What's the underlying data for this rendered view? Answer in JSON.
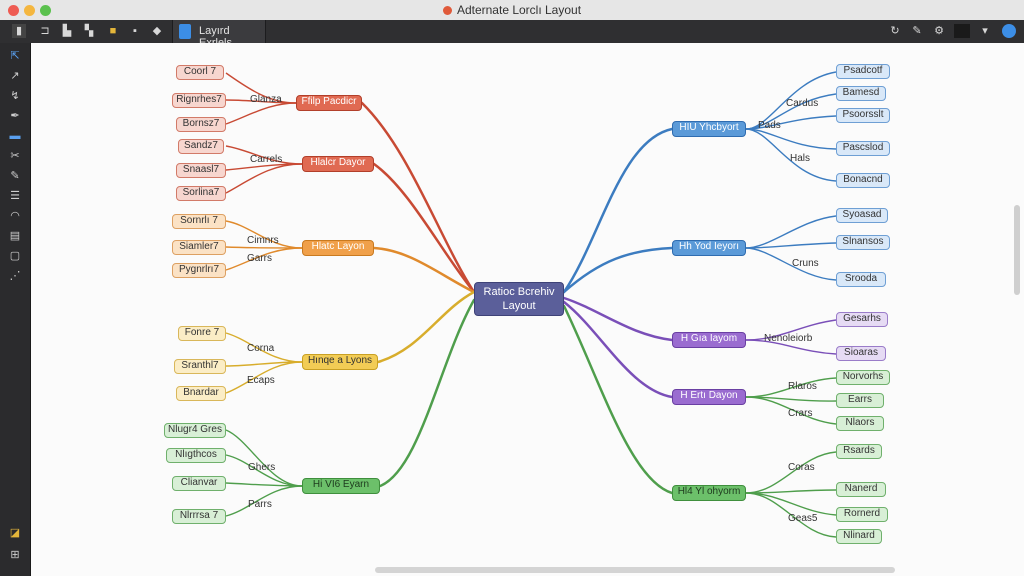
{
  "window": {
    "title": "Adternate Lorclı Layout"
  },
  "tab": {
    "label": "Layırd Exrlels"
  },
  "toolbar": {
    "left_icons": [
      "sidebar-icon",
      "back-icon",
      "copy-icon",
      "file-icon",
      "doc-icon",
      "cube-icon"
    ],
    "right_icons": [
      "refresh-icon",
      "pin-icon",
      "settings-icon",
      "square-icon",
      "chevron-down-icon",
      "profile-icon"
    ]
  },
  "mindmap": {
    "center": {
      "line1": "Ratioc Bcrehiv",
      "line2": "Layout"
    },
    "left": [
      {
        "label": "Ffilp Pacdicr",
        "color": "#e06a52",
        "border": "#b23f2a",
        "mid": "Glanza",
        "leaves": [
          "Coorl 7",
          "Rignrhes7",
          "Bornsz7"
        ]
      },
      {
        "label": "Hlalcr Dayor",
        "color": "#e06a52",
        "border": "#b23f2a",
        "mid": "Carrels",
        "leaves": [
          "Sandz7",
          "Snaasl7",
          "Sorlina7"
        ]
      },
      {
        "label": "Hlatc Layon",
        "color": "#f0a04a",
        "border": "#c97a20",
        "mid1": "Cimnrs",
        "mid2": "Garrs",
        "leaves": [
          "Sornrlı 7",
          "Siamler7",
          "Pygnrlrı7"
        ]
      },
      {
        "label": "Hınqe a Lyons",
        "color": "#f2cc55",
        "border": "#c9a024",
        "mid1": "Corna",
        "mid2": "Ecaps",
        "leaves": [
          "Fonre 7",
          "Sranthl7",
          "Bnardar"
        ]
      },
      {
        "label": "Hi VI6 Eyarn",
        "color": "#6cc06a",
        "border": "#3f8f3d",
        "mid1": "Ghers",
        "mid2": "Parrs",
        "leaves": [
          "Nlugr4 Gres",
          "Nlıgthcos",
          "Clianvar",
          "Nlrrrsa 7"
        ]
      }
    ],
    "right": [
      {
        "label": "HIU Yhcbyort",
        "color": "#5b9ad8",
        "border": "#2f6cb0",
        "mids": [
          "Pads",
          "Cardus",
          "Hals"
        ],
        "leaves": [
          "Psadcotf",
          "Bamesd",
          "Psoorsslt",
          "Pascslod",
          "Bonacnd"
        ]
      },
      {
        "label": "Hh Yod Ieyorı",
        "color": "#5b9ad8",
        "border": "#2f6cb0",
        "mids": [
          "Cruns"
        ],
        "leaves": [
          "Syoasad",
          "Slnansos",
          "Srooda"
        ]
      },
      {
        "label": "H Gıa Iayom",
        "color": "#9a6cd0",
        "border": "#6a3fa3",
        "mids": [
          "Nenoleiorb"
        ],
        "leaves": [
          "Gesarhs",
          "Sioaras"
        ]
      },
      {
        "label": "H Ertı Dayon",
        "color": "#9a6cd0",
        "border": "#6a3fa3",
        "mids": [
          "Rlaros",
          "Crars"
        ],
        "leaves": [
          "Norvorhs",
          "Earrs",
          "Nlaors"
        ]
      },
      {
        "label": "Hl4 Yl ohyorm",
        "color": "#6cc06a",
        "border": "#3f8f3d",
        "mids": [
          "Coras",
          "Geas5"
        ],
        "leaves": [
          "Rsards",
          "Nanerd",
          "Rornerd",
          "Nlinard"
        ]
      }
    ]
  }
}
